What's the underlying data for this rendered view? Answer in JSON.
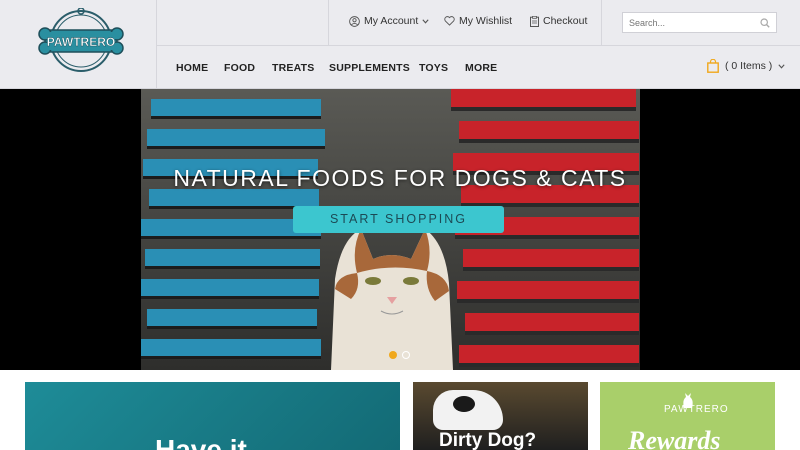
{
  "brand": {
    "logo_text": "PAWTRERO",
    "accent": "#3cc6cf",
    "logo_color": "#2a8fa0"
  },
  "header": {
    "account_label": "My Account",
    "wishlist_label": "My Wishlist",
    "checkout_label": "Checkout",
    "search_placeholder": "Search...",
    "cart_label": "( 0 Items )"
  },
  "nav": {
    "items": [
      "HOME",
      "FOOD",
      "TREATS",
      "SUPPLEMENTS",
      "TOYS",
      "MORE"
    ]
  },
  "hero": {
    "title": "NATURAL FOODS FOR DOGS & CATS",
    "button_label": "START SHOPPING",
    "slide_count": 2,
    "active_slide": 1
  },
  "tiles": [
    {
      "text": "Have it"
    },
    {
      "text": "Dirty Dog?"
    },
    {
      "text": "Rewards",
      "brand": "PAWTRERO"
    }
  ],
  "colors": {
    "header_bg": "#ebebef",
    "dot_active": "#f0a81c",
    "cart_icon": "#f0a81c"
  }
}
